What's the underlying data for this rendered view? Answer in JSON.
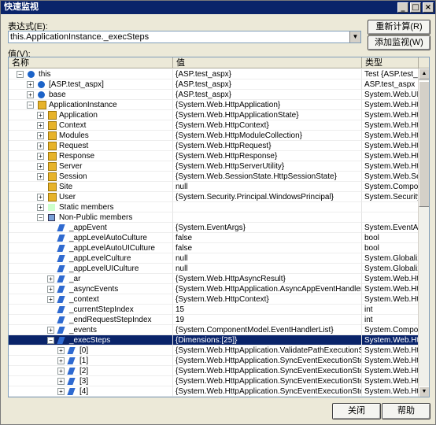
{
  "window": {
    "title": "快速监视",
    "min": "_",
    "max": "□",
    "close": "×"
  },
  "labels": {
    "expr": "表达式(E):",
    "value": "值(V):"
  },
  "expression": "this.ApplicationInstance._execSteps",
  "buttons": {
    "recalc": "重新计算(R)",
    "addwatch": "添加监视(W)",
    "close": "关闭",
    "help": "帮助"
  },
  "columns": [
    "名称",
    "值",
    "类型"
  ],
  "rows": [
    {
      "indent": 0,
      "exp": "−",
      "icon": "b",
      "name": "this",
      "value": "{ASP.test_aspx}",
      "type": "Test {ASP.test_asp"
    },
    {
      "indent": 1,
      "exp": "+",
      "icon": "b",
      "name": "[ASP.test_aspx]",
      "value": "{ASP.test_aspx}",
      "type": "ASP.test_aspx"
    },
    {
      "indent": 1,
      "exp": "+",
      "icon": "b",
      "name": "base",
      "value": "{ASP.test_aspx}",
      "type": "System.Web.UI.Pa"
    },
    {
      "indent": 1,
      "exp": "−",
      "icon": "f",
      "name": "ApplicationInstance",
      "value": "{System.Web.HttpApplication}",
      "type": "System.Web.HttpA"
    },
    {
      "indent": 2,
      "exp": "+",
      "icon": "f",
      "name": "Application",
      "value": "{System.Web.HttpApplicationState}",
      "type": "System.Web.HttpA"
    },
    {
      "indent": 2,
      "exp": "+",
      "icon": "f",
      "name": "Context",
      "value": "{System.Web.HttpContext}",
      "type": "System.Web.HttpC"
    },
    {
      "indent": 2,
      "exp": "+",
      "icon": "f",
      "name": "Modules",
      "value": "{System.Web.HttpModuleCollection}",
      "type": "System.Web.HttpM"
    },
    {
      "indent": 2,
      "exp": "+",
      "icon": "f",
      "name": "Request",
      "value": "{System.Web.HttpRequest}",
      "type": "System.Web.HttpR"
    },
    {
      "indent": 2,
      "exp": "+",
      "icon": "f",
      "name": "Response",
      "value": "{System.Web.HttpResponse}",
      "type": "System.Web.HttpR"
    },
    {
      "indent": 2,
      "exp": "+",
      "icon": "f",
      "name": "Server",
      "value": "{System.Web.HttpServerUtility}",
      "type": "System.Web.HttpS"
    },
    {
      "indent": 2,
      "exp": "+",
      "icon": "f",
      "name": "Session",
      "value": "{System.Web.SessionState.HttpSessionState}",
      "type": "System.Web.Sessi"
    },
    {
      "indent": 2,
      "exp": "",
      "icon": "f",
      "name": "Site",
      "value": "null",
      "type": "System.Componen"
    },
    {
      "indent": 2,
      "exp": "+",
      "icon": "f",
      "name": "User",
      "value": "{System.Security.Principal.WindowsPrincipal}",
      "type": "System.Security.Pr"
    },
    {
      "indent": 2,
      "exp": "+",
      "icon": "s",
      "name": "Static members",
      "value": "",
      "type": ""
    },
    {
      "indent": 2,
      "exp": "−",
      "icon": "m",
      "name": "Non-Public members",
      "value": "",
      "type": ""
    },
    {
      "indent": 3,
      "exp": "",
      "icon": "p",
      "name": "_appEvent",
      "value": "{System.EventArgs}",
      "type": "System.EventArgs"
    },
    {
      "indent": 3,
      "exp": "",
      "icon": "p",
      "name": "_appLevelAutoCulture",
      "value": "false",
      "type": "bool"
    },
    {
      "indent": 3,
      "exp": "",
      "icon": "p",
      "name": "_appLevelAutoUICulture",
      "value": "false",
      "type": "bool"
    },
    {
      "indent": 3,
      "exp": "",
      "icon": "p",
      "name": "_appLevelCulture",
      "value": "null",
      "type": "System.Globalizatio"
    },
    {
      "indent": 3,
      "exp": "",
      "icon": "p",
      "name": "_appLevelUICulture",
      "value": "null",
      "type": "System.Globalizatio"
    },
    {
      "indent": 3,
      "exp": "+",
      "icon": "p",
      "name": "_ar",
      "value": "{System.Web.HttpAsyncResult}",
      "type": "System.Web.HttpA"
    },
    {
      "indent": 3,
      "exp": "+",
      "icon": "p",
      "name": "_asyncEvents",
      "value": "{System.Web.HttpApplication.AsyncAppEventHandlersTable}",
      "type": "System.Web.HttpA"
    },
    {
      "indent": 3,
      "exp": "+",
      "icon": "p",
      "name": "_context",
      "value": "{System.Web.HttpContext}",
      "type": "System.Web.HttpC"
    },
    {
      "indent": 3,
      "exp": "",
      "icon": "p",
      "name": "_currentStepIndex",
      "value": "15",
      "type": "int"
    },
    {
      "indent": 3,
      "exp": "",
      "icon": "p",
      "name": "_endRequestStepIndex",
      "value": "19",
      "type": "int"
    },
    {
      "indent": 3,
      "exp": "+",
      "icon": "p",
      "name": "_events",
      "value": "{System.ComponentModel.EventHandlerList}",
      "type": "System.Componen"
    },
    {
      "indent": 3,
      "exp": "−",
      "icon": "p",
      "name": "_execSteps",
      "value": "{Dimensions:[25]}",
      "type": "System.Web.HttpA",
      "sel": true
    },
    {
      "indent": 4,
      "exp": "+",
      "icon": "p",
      "name": "[0]",
      "value": "{System.Web.HttpApplication.ValidatePathExecutionStep}",
      "type": "System.Web.HttpA"
    },
    {
      "indent": 4,
      "exp": "+",
      "icon": "p",
      "name": "[1]",
      "value": "{System.Web.HttpApplication.SyncEventExecutionStep}",
      "type": "System.Web.HttpA"
    },
    {
      "indent": 4,
      "exp": "+",
      "icon": "p",
      "name": "[2]",
      "value": "{System.Web.HttpApplication.SyncEventExecutionStep}",
      "type": "System.Web.HttpA"
    },
    {
      "indent": 4,
      "exp": "+",
      "icon": "p",
      "name": "[3]",
      "value": "{System.Web.HttpApplication.SyncEventExecutionStep}",
      "type": "System.Web.HttpA"
    },
    {
      "indent": 4,
      "exp": "+",
      "icon": "p",
      "name": "[4]",
      "value": "{System.Web.HttpApplication.SyncEventExecutionStep}",
      "type": "System.Web.HttpA"
    }
  ]
}
